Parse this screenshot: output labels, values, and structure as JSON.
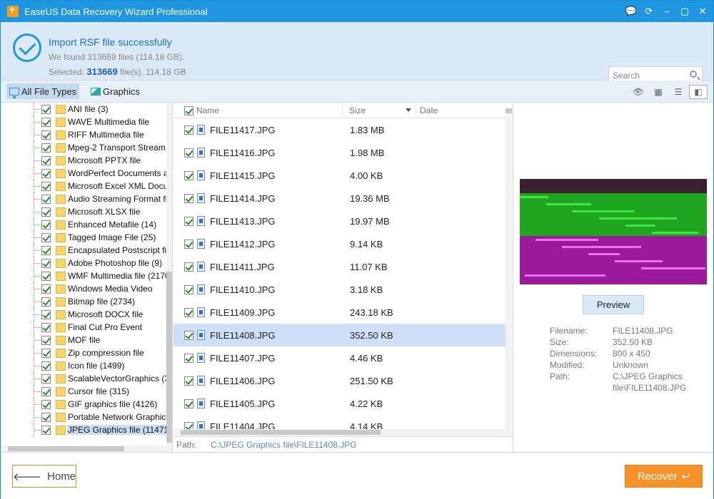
{
  "window": {
    "title": "EaseUS Data Recovery Wizard Professional",
    "buttons": [
      "💬",
      "⟳",
      "−",
      "▢",
      "✕"
    ]
  },
  "status": {
    "title": "Import RSF file successfully",
    "found": "We found 313669 files (114.18 GB).",
    "selected_prefix": "Selected: ",
    "selected_count": "313669",
    "selected_suffix": " file(s), 114.18 GB"
  },
  "search": {
    "placeholder": "Search"
  },
  "tabs": [
    {
      "label": "All File Types",
      "icon": "monitor-icon",
      "active": true
    },
    {
      "label": "Graphics",
      "icon": "image-icon",
      "active": false
    }
  ],
  "view_buttons": [
    {
      "name": "preview-eye-icon",
      "glyph": "👁"
    },
    {
      "name": "thumbnail-view-icon",
      "glyph": "▦"
    },
    {
      "name": "list-view-icon",
      "glyph": "☰"
    },
    {
      "name": "detail-view-icon",
      "glyph": "◧"
    }
  ],
  "tree": [
    "ANI file (3)",
    "WAVE Multimedia file",
    "RIFF Multimedia file",
    "Mpeg-2 Transport Stream",
    "Microsoft PPTX file",
    "WordPerfect Documents a",
    "Microsoft Excel XML Docu",
    "Audio Streaming Format fi",
    "Microsoft XLSX file",
    "Enhanced Metafile (14)",
    "Tagged Image File (25)",
    "Encapsulated Postscript fil",
    "Adobe Photoshop file (9)",
    "WMF Multimedia file (2170",
    "Windows Media Video",
    "Bitmap file (2734)",
    "Microsoft DOCX file",
    "Final Cut Pro Event",
    "MOF file",
    "Zip compression file",
    "Icon file (1499)",
    "ScalableVectorGraphics (31",
    "Cursor file (315)",
    "GIF graphics file (4126)",
    "Portable Network Graphic",
    "JPEG Graphics file (11471)"
  ],
  "tree_selected": 25,
  "columns": {
    "name": "Name",
    "size": "Size",
    "date": "Date"
  },
  "files": [
    {
      "name": "FILE11417.JPG",
      "size": "1.83 MB"
    },
    {
      "name": "FILE11416.JPG",
      "size": "1.98 MB"
    },
    {
      "name": "FILE11415.JPG",
      "size": "4.00 KB"
    },
    {
      "name": "FILE11414.JPG",
      "size": "19.36 MB"
    },
    {
      "name": "FILE11413.JPG",
      "size": "19.97 MB"
    },
    {
      "name": "FILE11412.JPG",
      "size": "9.14 KB"
    },
    {
      "name": "FILE11411.JPG",
      "size": "11.07 KB"
    },
    {
      "name": "FILE11410.JPG",
      "size": "3.18 KB"
    },
    {
      "name": "FILE11409.JPG",
      "size": "243.18 KB"
    },
    {
      "name": "FILE11408.JPG",
      "size": "352.50 KB"
    },
    {
      "name": "FILE11407.JPG",
      "size": "4.46 KB"
    },
    {
      "name": "FILE11406.JPG",
      "size": "251.50 KB"
    },
    {
      "name": "FILE11405.JPG",
      "size": "4.22 KB"
    },
    {
      "name": "FILE11404.JPG",
      "size": "4.14 KB"
    }
  ],
  "selected_file": 9,
  "path": {
    "label": "Path:",
    "value": "C:\\JPEG Graphics file\\FILE11408.JPG"
  },
  "preview": {
    "button": "Preview",
    "info": [
      {
        "k": "Filename:",
        "v": "FILE11408.JPG"
      },
      {
        "k": "Size:",
        "v": "352.50 KB"
      },
      {
        "k": "Dimensions:",
        "v": "800 x 450"
      },
      {
        "k": "Modified:",
        "v": "Unknown"
      },
      {
        "k": "Path:",
        "v": "C:\\JPEG Graphics"
      },
      {
        "k": "",
        "v": "file\\FILE11408.JPG"
      }
    ]
  },
  "footer": {
    "home": "Home",
    "recover": "Recover"
  },
  "colors": {
    "accent": "#1e96e0",
    "orange": "#f7922a",
    "selection": "#cde0f7"
  }
}
